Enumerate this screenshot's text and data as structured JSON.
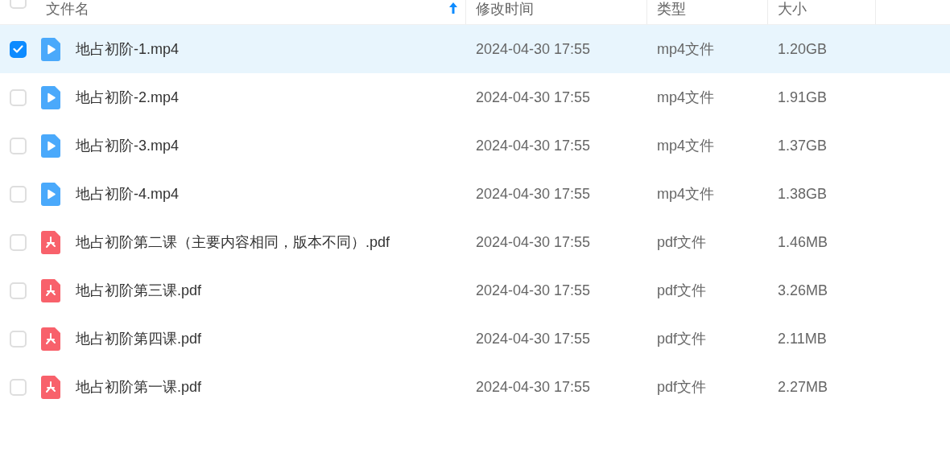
{
  "header": {
    "select_all": {
      "checked": false
    },
    "columns": [
      {
        "label": "文件名",
        "sorted": true
      },
      {
        "label": "修改时间",
        "sorted": false
      },
      {
        "label": "类型",
        "sorted": false
      },
      {
        "label": "大小",
        "sorted": false
      }
    ]
  },
  "rows": [
    {
      "name": "地占初阶-1.mp4",
      "kind": "video",
      "modified": "2024-04-30 17:55",
      "type": "mp4文件",
      "size": "1.20GB",
      "selected": true
    },
    {
      "name": "地占初阶-2.mp4",
      "kind": "video",
      "modified": "2024-04-30 17:55",
      "type": "mp4文件",
      "size": "1.91GB",
      "selected": false
    },
    {
      "name": "地占初阶-3.mp4",
      "kind": "video",
      "modified": "2024-04-30 17:55",
      "type": "mp4文件",
      "size": "1.37GB",
      "selected": false
    },
    {
      "name": "地占初阶-4.mp4",
      "kind": "video",
      "modified": "2024-04-30 17:55",
      "type": "mp4文件",
      "size": "1.38GB",
      "selected": false
    },
    {
      "name": "地占初阶第二课（主要内容相同，版本不同）.pdf",
      "kind": "pdf",
      "modified": "2024-04-30 17:55",
      "type": "pdf文件",
      "size": "1.46MB",
      "selected": false
    },
    {
      "name": "地占初阶第三课.pdf",
      "kind": "pdf",
      "modified": "2024-04-30 17:55",
      "type": "pdf文件",
      "size": "3.26MB",
      "selected": false
    },
    {
      "name": "地占初阶第四课.pdf",
      "kind": "pdf",
      "modified": "2024-04-30 17:55",
      "type": "pdf文件",
      "size": "2.11MB",
      "selected": false
    },
    {
      "name": "地占初阶第一课.pdf",
      "kind": "pdf",
      "modified": "2024-04-30 17:55",
      "type": "pdf文件",
      "size": "2.27MB",
      "selected": false
    }
  ]
}
